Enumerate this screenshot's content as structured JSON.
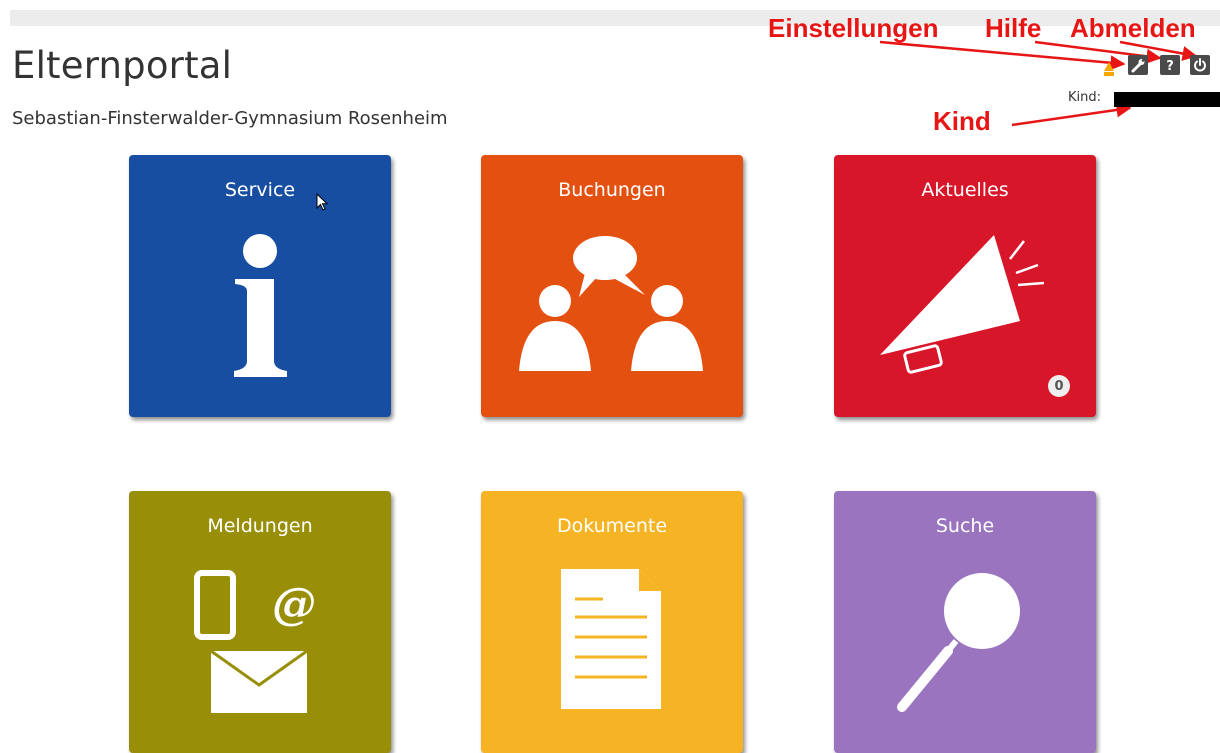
{
  "header": {
    "title": "Elternportal",
    "subtitle": "Sebastian-Finsterwalder-Gymnasium Rosenheim",
    "kind_label": "Kind:",
    "icons": [
      "language-icon",
      "settings-icon",
      "help-icon",
      "logout-icon"
    ]
  },
  "annotations": {
    "settings": "Einstellungen",
    "help": "Hilfe",
    "logout": "Abmelden",
    "kind": "Kind"
  },
  "tiles": [
    {
      "label": "Service",
      "color": "#174ea2",
      "icon": "info-icon"
    },
    {
      "label": "Buchungen",
      "color": "#e3500f",
      "icon": "people-talking-icon"
    },
    {
      "label": "Aktuelles",
      "color": "#d8162a",
      "icon": "megaphone-icon",
      "badge": "0"
    },
    {
      "label": "Meldungen",
      "color": "#988e08",
      "icon": "phone-at-mail-icon"
    },
    {
      "label": "Dokumente",
      "color": "#f6b323",
      "icon": "document-icon"
    },
    {
      "label": "Suche",
      "color": "#9a74bf",
      "icon": "magnifier-icon"
    }
  ],
  "colors": {
    "annotation": "#e81515",
    "icon_bg": "#4a4a4a"
  }
}
